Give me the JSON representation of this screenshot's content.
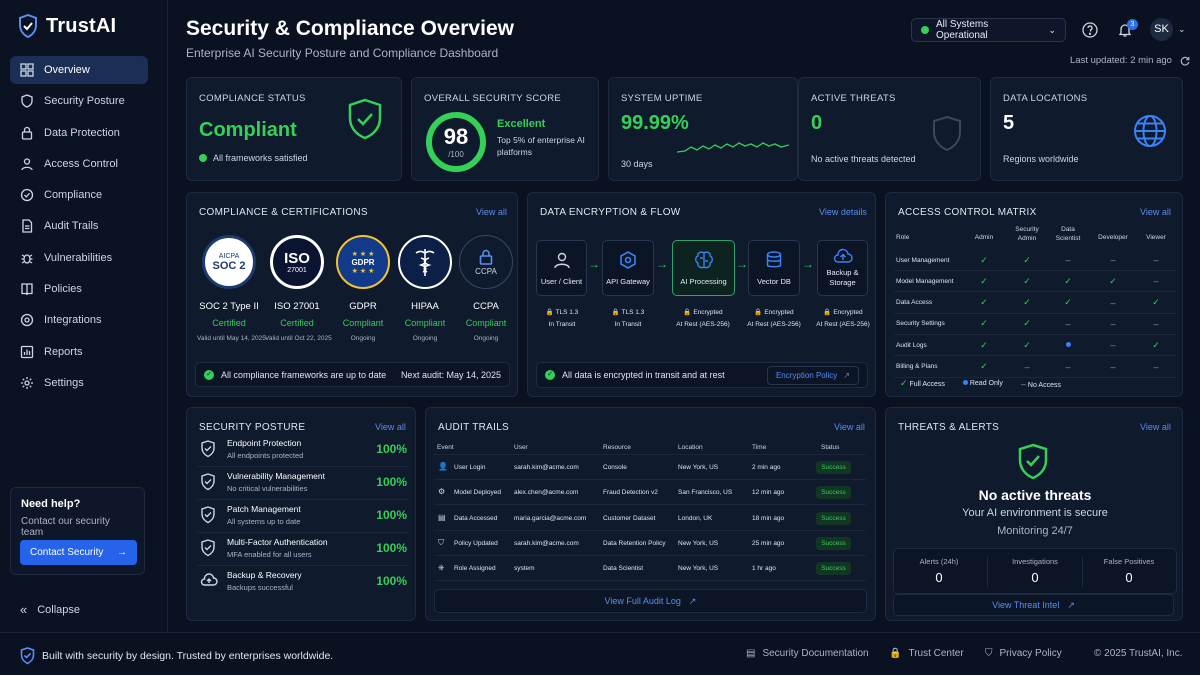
{
  "brand": {
    "name": "TrustAI"
  },
  "sidebar": {
    "items": [
      {
        "label": "Overview",
        "icon": "grid-icon"
      },
      {
        "label": "Security Posture",
        "icon": "shield-icon"
      },
      {
        "label": "Data Protection",
        "icon": "lock-icon"
      },
      {
        "label": "Access Control",
        "icon": "person-icon"
      },
      {
        "label": "Compliance",
        "icon": "check-circle-icon"
      },
      {
        "label": "Audit Trails",
        "icon": "document-icon"
      },
      {
        "label": "Vulnerabilities",
        "icon": "bug-icon"
      },
      {
        "label": "Policies",
        "icon": "book-icon"
      },
      {
        "label": "Integrations",
        "icon": "plug-icon"
      },
      {
        "label": "Reports",
        "icon": "bar-chart-icon"
      },
      {
        "label": "Settings",
        "icon": "gear-icon"
      }
    ],
    "help": {
      "title": "Need help?",
      "text": "Contact our security team",
      "button": "Contact Security"
    },
    "collapse": "Collapse"
  },
  "header": {
    "title": "Security & Compliance Overview",
    "subtitle": "Enterprise AI Security Posture and Compliance Dashboard",
    "status": "All Systems Operational",
    "notifications": "3",
    "avatar": "SK",
    "last_updated": "Last updated: 2 min ago"
  },
  "kpis": {
    "compliance": {
      "label": "COMPLIANCE STATUS",
      "value": "Compliant",
      "note": "All frameworks satisfied"
    },
    "score": {
      "label": "OVERALL SECURITY SCORE",
      "value": "98",
      "max": "/100",
      "fraction": 0.98,
      "rating": "Excellent",
      "note": "Top 5% of enterprise AI platforms"
    },
    "uptime": {
      "label": "SYSTEM UPTIME",
      "value": "99.99%",
      "period": "30 days"
    },
    "threats": {
      "label": "ACTIVE THREATS",
      "value": "0",
      "note": "No active threats detected"
    },
    "locations": {
      "label": "DATA LOCATIONS",
      "value": "5",
      "note": "Regions worldwide"
    }
  },
  "certs": {
    "title": "COMPLIANCE & CERTIFICATIONS",
    "view": "View all",
    "items": [
      {
        "badge_top": "AICPA",
        "badge_main": "SOC 2",
        "name": "SOC 2 Type II",
        "status": "Certified",
        "valid": "Valid until May 14, 2025"
      },
      {
        "badge_top": "ISO",
        "badge_main": "27001",
        "name": "ISO 27001",
        "status": "Certified",
        "valid": "Valid until Oct 22, 2025"
      },
      {
        "badge_top": "",
        "badge_main": "GDPR",
        "name": "GDPR",
        "status": "Compliant",
        "valid": "Ongoing"
      },
      {
        "badge_top": "",
        "badge_main": "",
        "name": "HIPAA",
        "status": "Compliant",
        "valid": "Ongoing"
      },
      {
        "badge_top": "",
        "badge_main": "CCPA",
        "name": "CCPA",
        "status": "Compliant",
        "valid": "Ongoing"
      }
    ],
    "footer_note": "All compliance frameworks are up to date",
    "next_audit": "Next audit: May 14, 2025"
  },
  "encryption": {
    "title": "DATA ENCRYPTION & FLOW",
    "view": "View details",
    "nodes": [
      {
        "label": "User / Client",
        "meta1": "TLS 1.3",
        "meta2": "In Transit"
      },
      {
        "label": "API Gateway",
        "meta1": "TLS 1.3",
        "meta2": "In Transit"
      },
      {
        "label": "AI Processing",
        "meta1": "Encrypted",
        "meta2": "At Rest (AES-256)"
      },
      {
        "label": "Vector DB",
        "meta1": "Encrypted",
        "meta2": "At Rest (AES-256)"
      },
      {
        "label": "Backup & Storage",
        "meta1": "Encrypted",
        "meta2": "At Rest (AES-256)"
      }
    ],
    "footer_note": "All data is encrypted in transit and at rest",
    "policy_link": "Encryption Policy"
  },
  "access": {
    "title": "ACCESS CONTROL MATRIX",
    "view": "View all",
    "columns": [
      "Role",
      "Admin",
      "Security Admin",
      "Data Scientist",
      "Developer",
      "Viewer"
    ],
    "rows": [
      {
        "role": "User Management",
        "cells": [
          "full",
          "full",
          "none",
          "none",
          "none"
        ]
      },
      {
        "role": "Model Management",
        "cells": [
          "full",
          "full",
          "full",
          "full",
          "none"
        ]
      },
      {
        "role": "Data Access",
        "cells": [
          "full",
          "full",
          "full",
          "none",
          "full"
        ]
      },
      {
        "role": "Security Settings",
        "cells": [
          "full",
          "full",
          "none",
          "none",
          "none"
        ]
      },
      {
        "role": "Audit Logs",
        "cells": [
          "full",
          "full",
          "read",
          "none",
          "full"
        ]
      },
      {
        "role": "Billing & Plans",
        "cells": [
          "full",
          "none",
          "none",
          "none",
          "none"
        ]
      }
    ],
    "legend": {
      "full": "Full Access",
      "read": "Read Only",
      "none": "No Access"
    }
  },
  "posture": {
    "title": "SECURITY POSTURE",
    "view": "View all",
    "items": [
      {
        "name": "Endpoint Protection",
        "desc": "All endpoints protected",
        "pct": "100%"
      },
      {
        "name": "Vulnerability Management",
        "desc": "No critical vulnerabilities",
        "pct": "100%"
      },
      {
        "name": "Patch Management",
        "desc": "All systems up to date",
        "pct": "100%"
      },
      {
        "name": "Multi-Factor Authentication",
        "desc": "MFA enabled for all users",
        "pct": "100%"
      },
      {
        "name": "Backup & Recovery",
        "desc": "Backups successful",
        "pct": "100%"
      }
    ]
  },
  "audit": {
    "title": "AUDIT TRAILS",
    "view": "View all",
    "columns": [
      "Event",
      "User",
      "Resource",
      "Location",
      "Time",
      "Status"
    ],
    "rows": [
      {
        "event": "User Login",
        "user": "sarah.kim@acme.com",
        "resource": "Console",
        "location": "New York, US",
        "time": "2 min ago",
        "status": "Success"
      },
      {
        "event": "Model Deployed",
        "user": "alex.chen@acme.com",
        "resource": "Fraud Detection v2",
        "location": "San Francisco, US",
        "time": "12 min ago",
        "status": "Success"
      },
      {
        "event": "Data Accessed",
        "user": "maria.garcia@acme.com",
        "resource": "Customer Dataset",
        "location": "London, UK",
        "time": "18 min ago",
        "status": "Success"
      },
      {
        "event": "Policy Updated",
        "user": "sarah.kim@acme.com",
        "resource": "Data Retention Policy",
        "location": "New York, US",
        "time": "25 min ago",
        "status": "Success"
      },
      {
        "event": "Role Assigned",
        "user": "system",
        "resource": "Data Scientist",
        "location": "New York, US",
        "time": "1 hr ago",
        "status": "Success"
      }
    ],
    "full_log": "View Full Audit Log"
  },
  "threats": {
    "title": "THREATS & ALERTS",
    "view": "View all",
    "headline": "No active threats",
    "sub": "Your AI environment is secure",
    "monitor": "Monitoring 24/7",
    "stats": [
      {
        "label": "Alerts (24h)",
        "value": "0"
      },
      {
        "label": "Investigations",
        "value": "0"
      },
      {
        "label": "False Positives",
        "value": "0"
      }
    ],
    "intel": "View Threat Intel"
  },
  "footer": {
    "tagline": "Built with security by design. Trusted by enterprises worldwide.",
    "docs": "Security Documentation",
    "trust": "Trust Center",
    "privacy": "Privacy Policy",
    "copyright": "© 2025 TrustAI, Inc."
  },
  "colors": {
    "accent": "#2563eb",
    "success": "#34d058",
    "background": "#0a1120",
    "card": "#0f1a2d"
  }
}
